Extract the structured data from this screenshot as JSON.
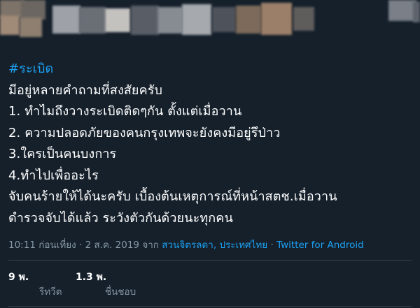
{
  "header": {
    "avatar": "blurred profile picture",
    "display_name": "blurred display name",
    "colors": {
      "background": "#15202b",
      "blur_tones": [
        "#8a7a6a",
        "#b09a85",
        "#6d6f74",
        "#9aa0a6",
        "#5e6168",
        "#c8c5c0",
        "#a68b75"
      ]
    }
  },
  "tweet": {
    "hashtag": "#ระเบิด",
    "lines": [
      "มีอยู่หลายคำถามที่สงสัยครับ",
      "1. ทำไมถึงวางระเบิดติดๆกัน ตั้งแต่เมื่อวาน",
      "2. ความปลอดภัยของคนกรุงเทพจะยังคงมีอยู่รึป่าว",
      "3.ใครเป็นคนบงการ",
      "4.ทำไปเพื่ออะไร",
      "จับคนร้ายให้ได้นะครับ เบื้องต้นเหตุการณ์ที่หน้าสตช.เมื่อวาน",
      "ดำรวจจับได้แล้ว ระวังตัวกันด้วยนะทุกคน"
    ]
  },
  "meta": {
    "time": "10:11 ก่อนเที่ยง",
    "separator": "·",
    "date": "2 ส.ค. 2019",
    "from_word": "จาก",
    "location": "สวนจิตรลดา, ประเทศไทย",
    "source": "Twitter for Android"
  },
  "stats": {
    "retweets_count": "9 พ.",
    "retweets_label": "รีทวีต",
    "likes_count": "1.3 พ.",
    "likes_label": "ชื่นชอบ"
  },
  "colors": {
    "accent": "#1da1f2",
    "text": "#ffffff",
    "secondary": "#8899a6",
    "divider": "#38444d"
  }
}
